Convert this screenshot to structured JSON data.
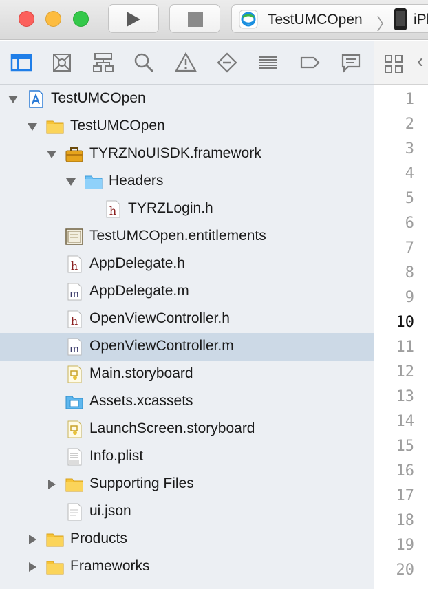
{
  "toolbar": {
    "scheme_name": "TestUMCOpen",
    "device_name": "iPh"
  },
  "navigator": {
    "buttons": [
      {
        "name": "project-navigator-icon"
      },
      {
        "name": "source-control-navigator-icon"
      },
      {
        "name": "symbol-navigator-icon"
      },
      {
        "name": "find-navigator-icon"
      },
      {
        "name": "issue-navigator-icon"
      },
      {
        "name": "test-navigator-icon"
      },
      {
        "name": "debug-navigator-icon"
      },
      {
        "name": "breakpoint-navigator-icon"
      },
      {
        "name": "report-navigator-icon"
      }
    ],
    "items": [
      {
        "label": "TestUMCOpen",
        "icon": "xcode-project-icon",
        "depth": 0,
        "disclosure": "open"
      },
      {
        "label": "TestUMCOpen",
        "icon": "folder-yellow-icon",
        "depth": 1,
        "disclosure": "open"
      },
      {
        "label": "TYRZNoUISDK.framework",
        "icon": "framework-toolbox-icon",
        "depth": 2,
        "disclosure": "open"
      },
      {
        "label": "Headers",
        "icon": "folder-blue-icon",
        "depth": 3,
        "disclosure": "open"
      },
      {
        "label": "TYRZLogin.h",
        "icon": "header-file-icon",
        "depth": 4,
        "disclosure": "none"
      },
      {
        "label": "TestUMCOpen.entitlements",
        "icon": "entitlements-file-icon",
        "depth": 2,
        "disclosure": "none"
      },
      {
        "label": "AppDelegate.h",
        "icon": "header-file-icon",
        "depth": 2,
        "disclosure": "none"
      },
      {
        "label": "AppDelegate.m",
        "icon": "implementation-file-icon",
        "depth": 2,
        "disclosure": "none"
      },
      {
        "label": "OpenViewController.h",
        "icon": "header-file-icon",
        "depth": 2,
        "disclosure": "none"
      },
      {
        "label": "OpenViewController.m",
        "icon": "implementation-file-icon",
        "depth": 2,
        "disclosure": "none",
        "selected": true
      },
      {
        "label": "Main.storyboard",
        "icon": "storyboard-file-icon",
        "depth": 2,
        "disclosure": "none"
      },
      {
        "label": "Assets.xcassets",
        "icon": "asset-catalog-icon",
        "depth": 2,
        "disclosure": "none"
      },
      {
        "label": "LaunchScreen.storyboard",
        "icon": "storyboard-file-icon",
        "depth": 2,
        "disclosure": "none"
      },
      {
        "label": "Info.plist",
        "icon": "plist-file-icon",
        "depth": 2,
        "disclosure": "none"
      },
      {
        "label": "Supporting Files",
        "icon": "folder-yellow-icon",
        "depth": 2,
        "disclosure": "closed"
      },
      {
        "label": "ui.json",
        "icon": "text-file-icon",
        "depth": 2,
        "disclosure": "none"
      },
      {
        "label": "Products",
        "icon": "folder-yellow-icon",
        "depth": 1,
        "disclosure": "closed"
      },
      {
        "label": "Frameworks",
        "icon": "folder-yellow-icon",
        "depth": 1,
        "disclosure": "closed"
      }
    ]
  },
  "editor": {
    "line_numbers": [
      "1",
      "2",
      "3",
      "4",
      "5",
      "6",
      "7",
      "8",
      "9",
      "10",
      "11",
      "12",
      "13",
      "14",
      "15",
      "16",
      "17",
      "18",
      "19",
      "20"
    ],
    "current_line": "10"
  }
}
